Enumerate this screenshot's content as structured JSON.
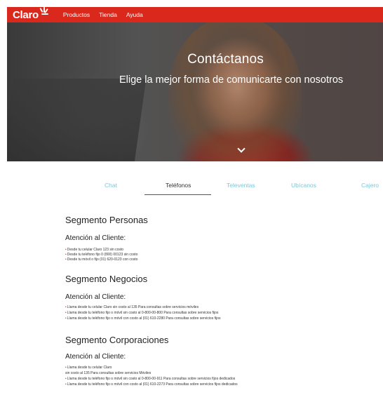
{
  "nav": {
    "logo": "Claro",
    "items": [
      "Productos",
      "Tienda",
      "Ayuda"
    ]
  },
  "hero": {
    "title": "Contáctanos",
    "subtitle": "Elige la mejor forma de comunicarte con nosotros"
  },
  "tabs": [
    "Chat",
    "Teléfonos",
    "Televentas",
    "Ubícanos",
    "Cajero"
  ],
  "active_tab": "Teléfonos",
  "sections": [
    {
      "title": "Segmento Personas",
      "subtitle": "Atención al Cliente:",
      "lines": [
        "Desde tu celular Claro 123 sin costo",
        "Desde tu teléfono fijo 0 (800) 00123 sin costo",
        "Desde tu móvil o fijo (01) 620-0123 con costo"
      ]
    },
    {
      "title": "Segmento Negocios",
      "subtitle": "Atención al Cliente:",
      "lines": [
        "Llama desde tu celular Claro sin costo al 135 Para consultas sobre servicios móviles",
        "Llama desde tu teléfono fijo o móvil sin costo al 0-800-00-800 Para consultas sobre servicios fijos",
        "Llama desde tu teléfono fijo o móvil con costo al (01) 610-2280 Para consultas sobre servicios fijos"
      ]
    },
    {
      "title": "Segmento Corporaciones",
      "subtitle": "Atención al Cliente:",
      "lines": [
        "Llama desde tu celular Claro",
        "sin costo al 135 Para consultas sobre servicios Móviles",
        "Llama desde tu teléfono fijo o móvil sin costo al 0-800-00-911 Para consultas sobre servicios fijos dedicados",
        "Llama desde tu teléfono fijo o móvil con costo al (01) 610-2273 Para consultas sobre servicios fijos dedicados"
      ]
    }
  ],
  "colors": {
    "brand": "#da291c",
    "tab_inactive": "#7fc6d6"
  }
}
